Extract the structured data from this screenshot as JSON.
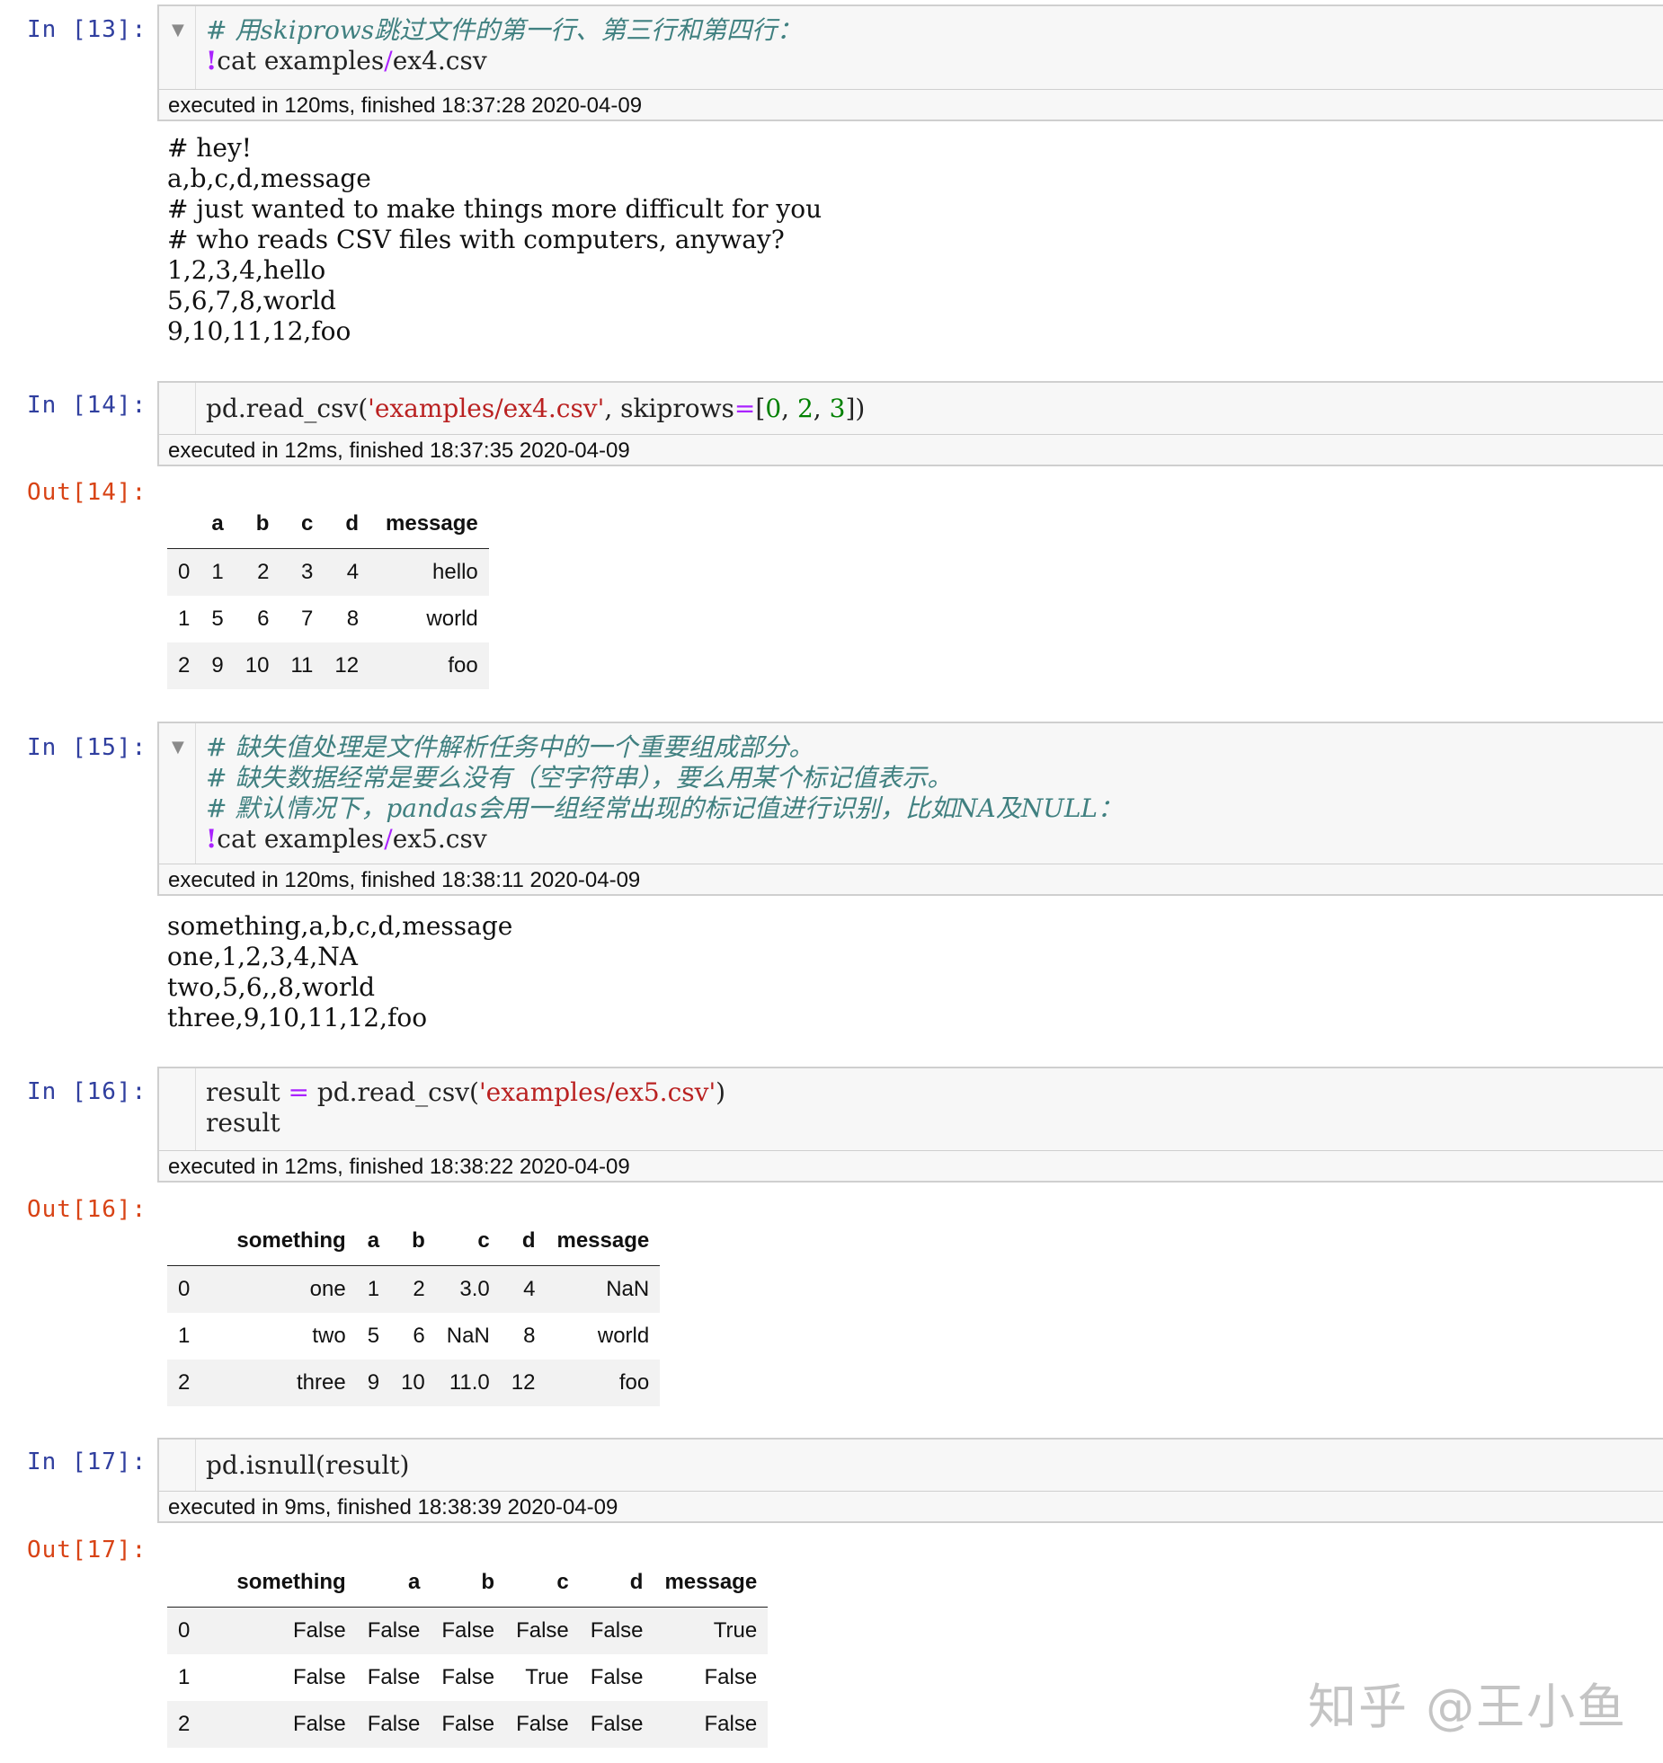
{
  "cells": [
    {
      "prompt": "In [13]:",
      "code_lines": [
        "# 用skiprows跳过文件的第一行、第三行和第四行：",
        "!cat examples/ex4.csv"
      ],
      "exec": "executed in 120ms, finished 18:37:28 2020-04-09",
      "stdout": [
        "# hey!",
        "a,b,c,d,message",
        "# just wanted to make things more difficult for you",
        "# who reads CSV files with computers, anyway?",
        "1,2,3,4,hello",
        "5,6,7,8,world",
        "9,10,11,12,foo"
      ]
    },
    {
      "prompt": "In [14]:",
      "code_lines": [
        "pd.read_csv('examples/ex4.csv', skiprows=[0, 2, 3])"
      ],
      "exec": "executed in 12ms, finished 18:37:35 2020-04-09",
      "out_prompt": "Out[14]:",
      "table": {
        "columns": [
          "a",
          "b",
          "c",
          "d",
          "message"
        ],
        "rows": [
          [
            "0",
            "1",
            "2",
            "3",
            "4",
            "hello"
          ],
          [
            "1",
            "5",
            "6",
            "7",
            "8",
            "world"
          ],
          [
            "2",
            "9",
            "10",
            "11",
            "12",
            "foo"
          ]
        ]
      }
    },
    {
      "prompt": "In [15]:",
      "code_lines": [
        "# 缺失值处理是文件解析任务中的一个重要组成部分。",
        "# 缺失数据经常是要么没有（空字符串），要么用某个标记值表示。",
        "# 默认情况下，pandas会用一组经常出现的标记值进行识别，比如NA及NULL：",
        "!cat examples/ex5.csv"
      ],
      "exec": "executed in 120ms, finished 18:38:11 2020-04-09",
      "stdout": [
        "something,a,b,c,d,message",
        "one,1,2,3,4,NA",
        "two,5,6,,8,world",
        "three,9,10,11,12,foo"
      ]
    },
    {
      "prompt": "In [16]:",
      "code_lines": [
        "result = pd.read_csv('examples/ex5.csv')",
        "result"
      ],
      "exec": "executed in 12ms, finished 18:38:22 2020-04-09",
      "out_prompt": "Out[16]:",
      "table": {
        "columns": [
          "something",
          "a",
          "b",
          "c",
          "d",
          "message"
        ],
        "rows": [
          [
            "0",
            "one",
            "1",
            "2",
            "3.0",
            "4",
            "NaN"
          ],
          [
            "1",
            "two",
            "5",
            "6",
            "NaN",
            "8",
            "world"
          ],
          [
            "2",
            "three",
            "9",
            "10",
            "11.0",
            "12",
            "foo"
          ]
        ]
      }
    },
    {
      "prompt": "In [17]:",
      "code_lines": [
        "pd.isnull(result)"
      ],
      "exec": "executed in 9ms, finished 18:38:39 2020-04-09",
      "out_prompt": "Out[17]:",
      "table": {
        "columns": [
          "something",
          "a",
          "b",
          "c",
          "d",
          "message"
        ],
        "rows": [
          [
            "0",
            "False",
            "False",
            "False",
            "False",
            "False",
            "True"
          ],
          [
            "1",
            "False",
            "False",
            "False",
            "True",
            "False",
            "False"
          ],
          [
            "2",
            "False",
            "False",
            "False",
            "False",
            "False",
            "False"
          ]
        ]
      }
    }
  ],
  "watermark": "知乎 @王小鱼",
  "icons": {
    "collapse": "triangle-down-icon"
  }
}
